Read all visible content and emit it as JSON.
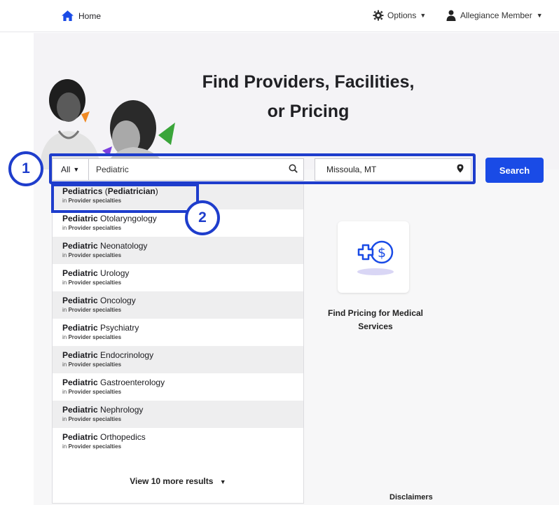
{
  "header": {
    "home_label": "Home",
    "options_label": "Options",
    "member_label": "Allegiance Member"
  },
  "hero": {
    "title_line1": "Find Providers, Facilities,",
    "title_line2": "or Pricing"
  },
  "search": {
    "scope_label": "All",
    "query_value": "Pediatric",
    "location_value": "Missoula, MT",
    "button_label": "Search"
  },
  "annotations": {
    "step1": "1",
    "step2": "2",
    "accent_color": "#1e3dcc"
  },
  "suggestions": [
    {
      "bold": "Pediatrics",
      "rest": " (Pediatrician)",
      "category_prefix": "in ",
      "category": "Provider specialties"
    },
    {
      "bold": "Pediatric",
      "rest": " Otolaryngology",
      "category_prefix": "in ",
      "category": "Provider specialties"
    },
    {
      "bold": "Pediatric",
      "rest": " Neonatology",
      "category_prefix": "in ",
      "category": "Provider specialties"
    },
    {
      "bold": "Pediatric",
      "rest": " Urology",
      "category_prefix": "in ",
      "category": "Provider specialties"
    },
    {
      "bold": "Pediatric",
      "rest": " Oncology",
      "category_prefix": "in ",
      "category": "Provider specialties"
    },
    {
      "bold": "Pediatric",
      "rest": " Psychiatry",
      "category_prefix": "in ",
      "category": "Provider specialties"
    },
    {
      "bold": "Pediatric",
      "rest": " Endocrinology",
      "category_prefix": "in ",
      "category": "Provider specialties"
    },
    {
      "bold": "Pediatric",
      "rest": " Gastroenterology",
      "category_prefix": "in ",
      "category": "Provider specialties"
    },
    {
      "bold": "Pediatric",
      "rest": " Nephrology",
      "category_prefix": "in ",
      "category": "Provider specialties"
    },
    {
      "bold": "Pediatric",
      "rest": " Orthopedics",
      "category_prefix": "in ",
      "category": "Provider specialties"
    }
  ],
  "view_more_label": "View 10 more results",
  "pricing": {
    "label_line1": "Find Pricing for Medical",
    "label_line2": "Services",
    "icon": "dollar-plus-icon"
  },
  "footer": {
    "disclaimers_label": "Disclaimers"
  },
  "colors": {
    "primary": "#1a4be6",
    "highlight": "#1e3dcc"
  }
}
